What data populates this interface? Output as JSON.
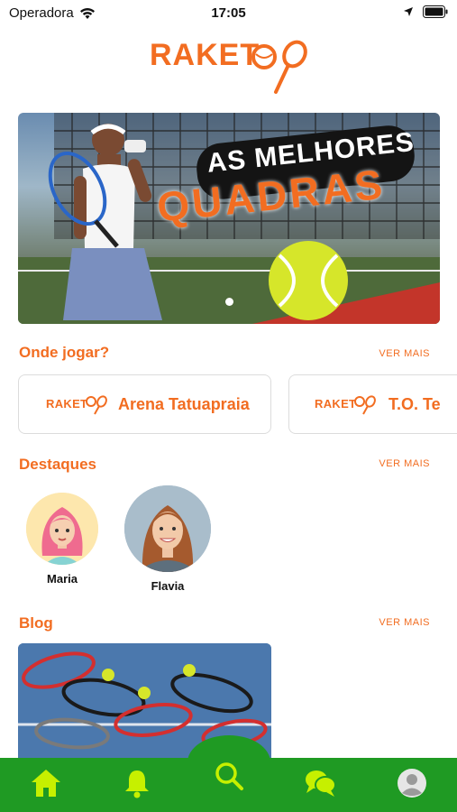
{
  "status": {
    "carrier": "Operadora",
    "time": "17:05"
  },
  "logo": {
    "text": "RAKET"
  },
  "banner": {
    "line1": "AS MELHORES",
    "line2": "QUADRAS",
    "active_slide": 1,
    "slides": 1
  },
  "sections": {
    "venues": {
      "title": "Onde jogar?",
      "see_more": "VER MAIS"
    },
    "highlights": {
      "title": "Destaques",
      "see_more": "VER MAIS"
    },
    "blog": {
      "title": "Blog",
      "see_more": "VER MAIS"
    }
  },
  "venues": [
    {
      "logo": "RAKET",
      "name": "Arena Tatuapraia"
    },
    {
      "logo": "RAKET",
      "name": "T.O. Te"
    }
  ],
  "highlights": [
    {
      "name": "Maria",
      "avatar": "cartoon-woman-pink-hair"
    },
    {
      "name": "Flavia",
      "avatar": "photo-woman-smiling"
    }
  ],
  "tabs": [
    {
      "name": "home",
      "icon": "home-icon"
    },
    {
      "name": "notifications",
      "icon": "bell-icon"
    },
    {
      "name": "search",
      "icon": "search-icon"
    },
    {
      "name": "messages",
      "icon": "chat-icon"
    },
    {
      "name": "profile",
      "icon": "user-icon"
    }
  ],
  "colors": {
    "brand_orange": "#f26d21",
    "tab_bar_green": "#1f9a23",
    "tab_icon_lime": "#c6f000"
  }
}
